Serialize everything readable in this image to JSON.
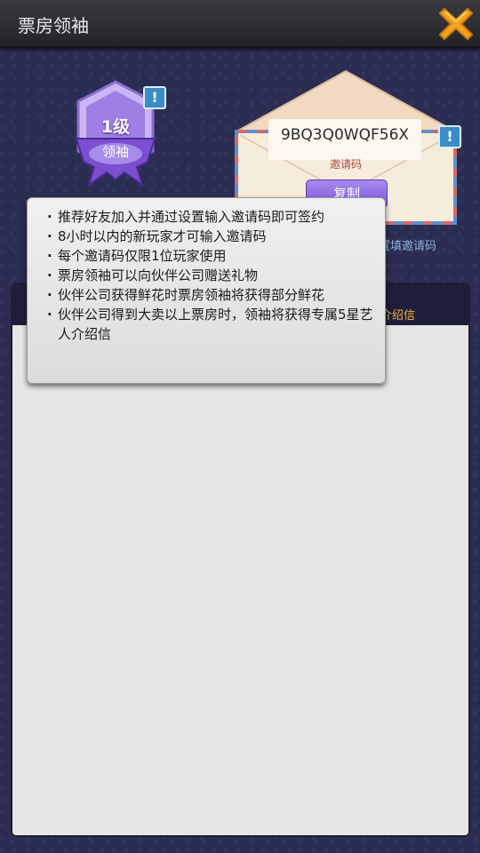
{
  "window": {
    "title": "票房领袖"
  },
  "icons": {
    "close": "close-icon",
    "info": "exclamation-icon"
  },
  "badge": {
    "level": "1级",
    "title": "领袖"
  },
  "invite": {
    "code": "9BQ3Q0WQF56X",
    "code_label": "邀请码",
    "copy_label": "复制",
    "hint": "置填邀请码"
  },
  "panel": {
    "header_fragment": "介绍信"
  },
  "tooltip": {
    "items": [
      "推荐好友加入并通过设置输入邀请码即可签约",
      "8小时以内的新玩家才可输入邀请码",
      "每个邀请码仅限1位玩家使用",
      "票房领袖可以向伙伴公司赠送礼物",
      "伙伴公司获得鲜花时票房领袖将获得部分鲜花",
      "伙伴公司得到大卖以上票房时，领袖将获得专属5星艺人介绍信"
    ]
  },
  "colors": {
    "accent_purple": "#7a55d6",
    "close_orange": "#f4a21c",
    "panel_header": "#1f1e3a",
    "header_text": "#f2b23a"
  }
}
